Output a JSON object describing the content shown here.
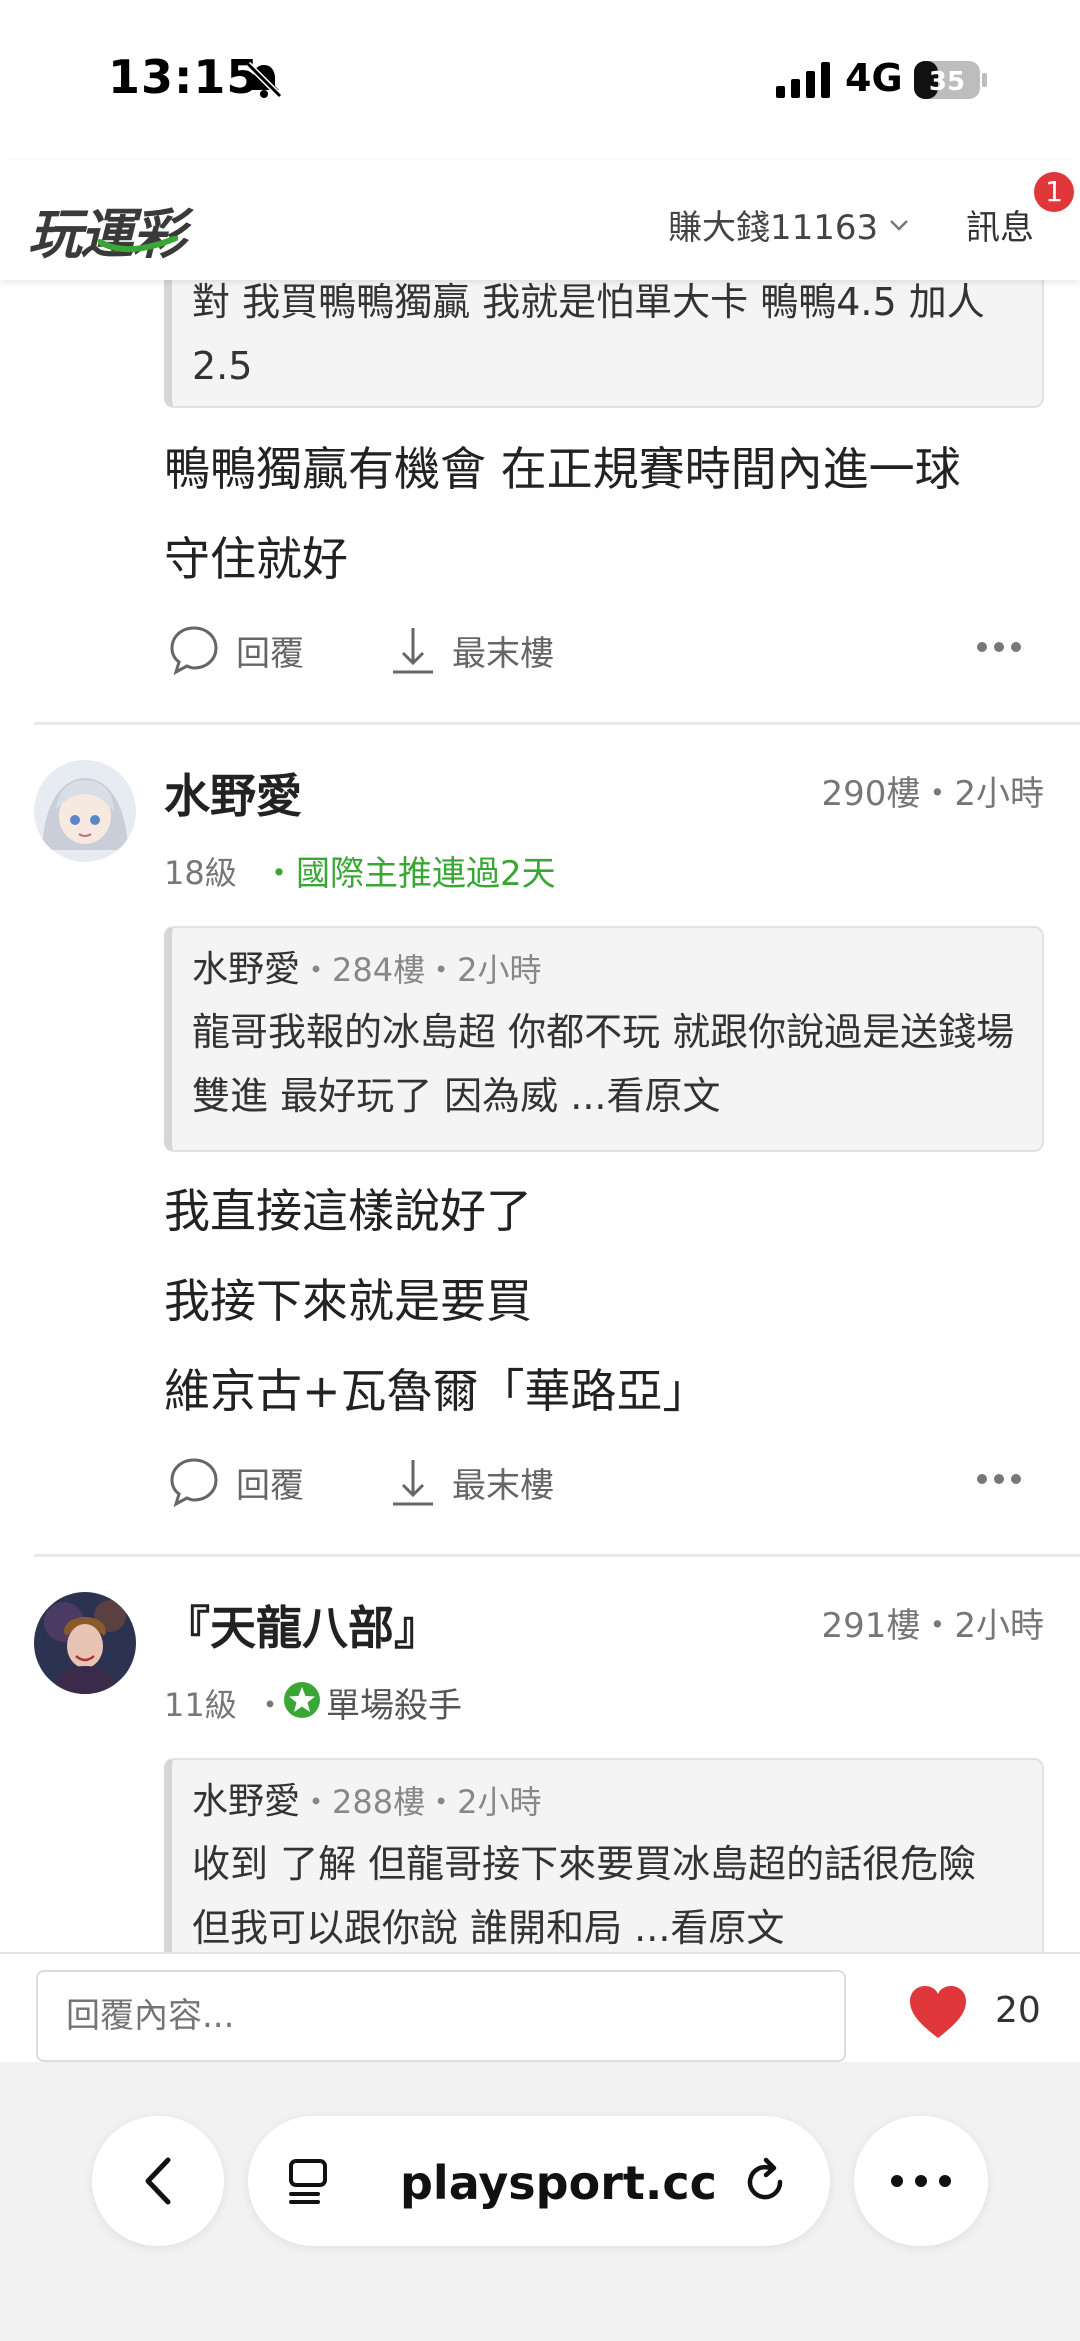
{
  "status_bar": {
    "time": "13:15",
    "network": "4G",
    "battery": "35"
  },
  "header": {
    "logo": "玩運彩",
    "user": "賺大錢11163",
    "messages_label": "訊息",
    "messages_badge": "1"
  },
  "top_fragment": {
    "quote_text": "對 我買鴨鴨獨贏 我就是怕單大卡 鴨鴨4.5 加人2.5",
    "body": [
      "鴨鴨獨贏有機會 在正規賽時間內進一球",
      "守住就好"
    ],
    "actions": {
      "reply": "回覆",
      "last_floor": "最末樓"
    }
  },
  "posts": [
    {
      "author": "水野愛",
      "floor": "290樓・2小時",
      "level": "18級",
      "tag": "・國際主推連過2天",
      "quote": {
        "author": "水野愛",
        "meta": "・284樓・2小時",
        "text": "龍哥我報的冰島超 你都不玩 就跟你說過是送錢場 雙進 最好玩了 因為威 ...看原文"
      },
      "body": [
        "我直接這樣說好了",
        "我接下來就是要買",
        "維京古+瓦魯爾「華路亞」"
      ],
      "actions": {
        "reply": "回覆",
        "last_floor": "最末樓"
      }
    },
    {
      "author": "『天龍八部』",
      "floor": "291樓・2小時",
      "level": "11級",
      "dot": "・",
      "tag": "單場殺手",
      "quote": {
        "author": "水野愛",
        "meta": "・288樓・2小時",
        "text": "收到 了解 但龍哥接下來要買冰島超的話很危險 但我可以跟你說 誰開和局 ...看原文"
      }
    }
  ],
  "reply_bar": {
    "placeholder": "回覆內容...",
    "likes": "20"
  },
  "browser": {
    "url": "playsport.cc"
  },
  "colors": {
    "accent_green": "#3aa636",
    "heart_red": "#e0373a",
    "badge_red": "#e0373a"
  }
}
